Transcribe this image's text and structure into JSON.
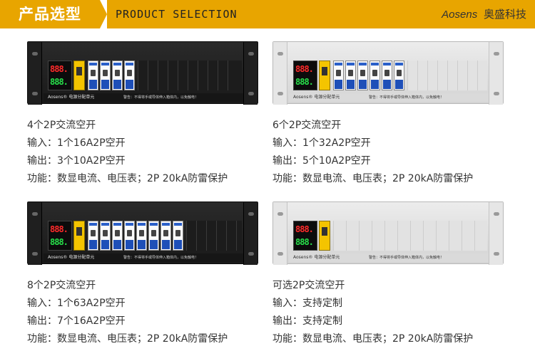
{
  "header": {
    "title_zh": "产品选型",
    "title_en": "PRODUCT SELECTION",
    "brand_en": "Aosens",
    "brand_zh": "奥盛科技",
    "accent_color": "#e8a500"
  },
  "panel_common": {
    "meter_red": "888.",
    "meter_green": "888.",
    "brand_label": "Aosens® 电源分配单元",
    "warning": "警告：不得将手或导体伸入箱体内，以免触电！"
  },
  "products": [
    {
      "finish": "black",
      "title": "4个2P交流空开",
      "input": "输入：1个16A2P空开",
      "output": "输出：3个10A2P空开",
      "function": "功能：数显电流、电压表；2P 20kA防雷保护"
    },
    {
      "finish": "silver",
      "title": "6个2P交流空开",
      "input": "输入：1个32A2P空开",
      "output": "输出：5个10A2P空开",
      "function": "功能：数显电流、电压表；2P 20kA防雷保护"
    },
    {
      "finish": "black",
      "title": "8个2P交流空开",
      "input": "输入：1个63A2P空开",
      "output": "输出：7个16A2P空开",
      "function": "功能：数显电流、电压表；2P 20kA防雷保护"
    },
    {
      "finish": "silver",
      "title": "可选2P交流空开",
      "input": "输入：支持定制",
      "output": "输出：支持定制",
      "function": "功能：数显电流、电压表；2P 20kA防雷保护"
    }
  ]
}
